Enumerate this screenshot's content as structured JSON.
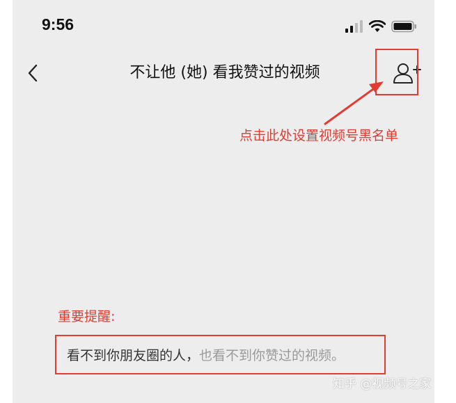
{
  "status_bar": {
    "time": "9:56"
  },
  "nav": {
    "title": "不让他 (她) 看我赞过的视频"
  },
  "annotation": {
    "text": "点击此处设置视频号黑名单"
  },
  "reminder": {
    "label": "重要提醒:",
    "text_primary": "看不到你朋友圈的人，",
    "text_secondary": "也看不到你赞过的视频。"
  },
  "watermark": {
    "text": "知乎 @视频号之家"
  },
  "colors": {
    "highlight": "#e23b30",
    "background": "#ededed",
    "text": "#111111",
    "muted": "#9a9a9a"
  }
}
